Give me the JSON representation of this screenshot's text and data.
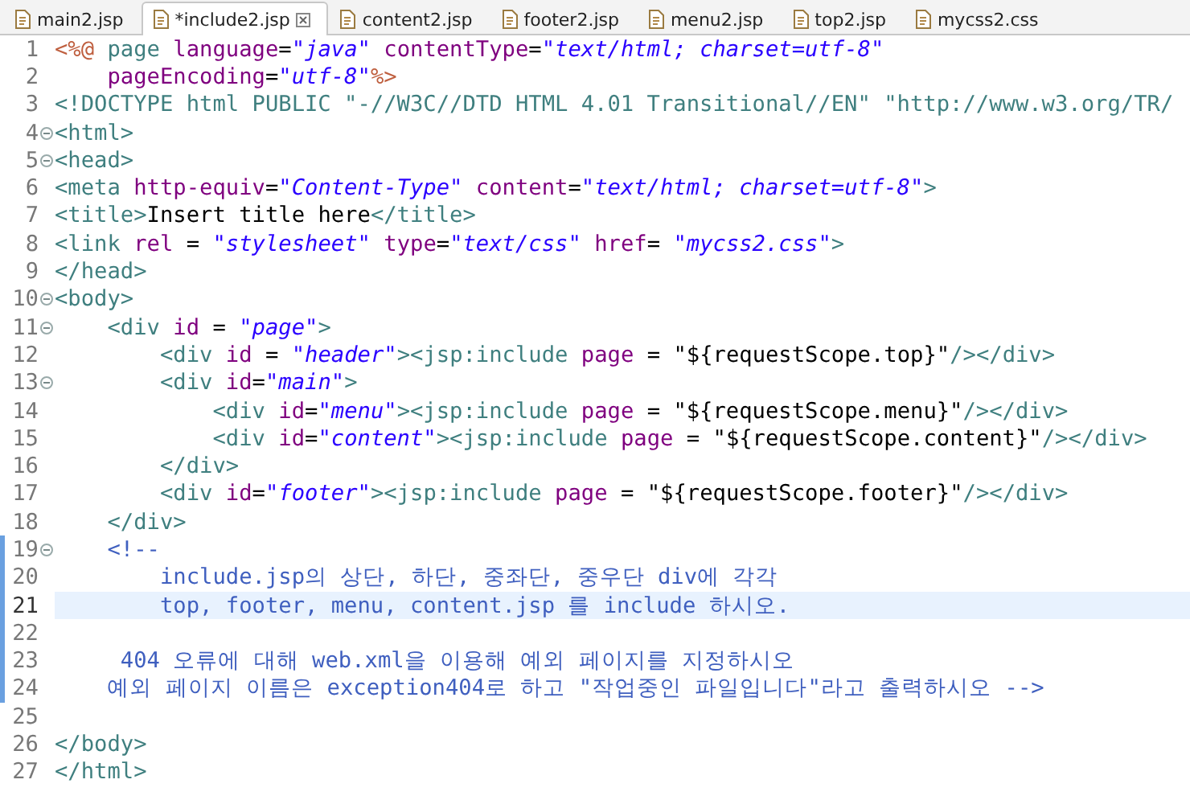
{
  "tabs": [
    {
      "label": "main2.jsp",
      "selected": false
    },
    {
      "label": "*include2.jsp",
      "selected": true
    },
    {
      "label": "content2.jsp",
      "selected": false
    },
    {
      "label": "footer2.jsp",
      "selected": false
    },
    {
      "label": "menu2.jsp",
      "selected": false
    },
    {
      "label": "top2.jsp",
      "selected": false
    },
    {
      "label": "mycss2.css",
      "selected": false
    }
  ],
  "lines": [
    {
      "number": "1",
      "fold": false,
      "changed": false,
      "current": false,
      "tokens": [
        {
          "kind": "directive",
          "text": "<%@"
        },
        {
          "kind": "tag",
          "text": " page"
        },
        {
          "kind": "attr",
          "text": " language"
        },
        {
          "kind": "text",
          "text": "="
        },
        {
          "kind": "string",
          "text": "\"java\""
        },
        {
          "kind": "attr",
          "text": " contentType"
        },
        {
          "kind": "text",
          "text": "="
        },
        {
          "kind": "string",
          "text": "\"text/html; charset=utf-8\""
        }
      ]
    },
    {
      "number": "2",
      "fold": false,
      "changed": false,
      "current": false,
      "tokens": [
        {
          "kind": "attr",
          "text": "    pageEncoding"
        },
        {
          "kind": "text",
          "text": "="
        },
        {
          "kind": "string",
          "text": "\"utf-8\""
        },
        {
          "kind": "directive",
          "text": "%>"
        }
      ]
    },
    {
      "number": "3",
      "fold": false,
      "changed": false,
      "current": false,
      "tokens": [
        {
          "kind": "tag",
          "text": "<!DOCTYPE html PUBLIC \"-//W3C//DTD HTML 4.01 Transitional//EN\" \"http://www.w3.org/TR/"
        }
      ]
    },
    {
      "number": "4",
      "fold": true,
      "changed": false,
      "current": false,
      "tokens": [
        {
          "kind": "tag",
          "text": "<html>"
        }
      ]
    },
    {
      "number": "5",
      "fold": true,
      "changed": false,
      "current": false,
      "tokens": [
        {
          "kind": "tag",
          "text": "<head>"
        }
      ]
    },
    {
      "number": "6",
      "fold": false,
      "changed": false,
      "current": false,
      "tokens": [
        {
          "kind": "tag",
          "text": "<meta"
        },
        {
          "kind": "attr",
          "text": " http-equiv"
        },
        {
          "kind": "text",
          "text": "="
        },
        {
          "kind": "string",
          "text": "\"Content-Type\""
        },
        {
          "kind": "attr",
          "text": " content"
        },
        {
          "kind": "text",
          "text": "="
        },
        {
          "kind": "string",
          "text": "\"text/html; charset=utf-8\""
        },
        {
          "kind": "tag",
          "text": ">"
        }
      ]
    },
    {
      "number": "7",
      "fold": false,
      "changed": false,
      "current": false,
      "tokens": [
        {
          "kind": "tag",
          "text": "<title>"
        },
        {
          "kind": "text",
          "text": "Insert title here"
        },
        {
          "kind": "tag",
          "text": "</title>"
        }
      ]
    },
    {
      "number": "8",
      "fold": false,
      "changed": false,
      "current": false,
      "tokens": [
        {
          "kind": "tag",
          "text": "<link"
        },
        {
          "kind": "attr",
          "text": " rel"
        },
        {
          "kind": "text",
          "text": " = "
        },
        {
          "kind": "string",
          "text": "\"stylesheet\""
        },
        {
          "kind": "attr",
          "text": " type"
        },
        {
          "kind": "text",
          "text": "="
        },
        {
          "kind": "string",
          "text": "\"text/css\""
        },
        {
          "kind": "attr",
          "text": " href"
        },
        {
          "kind": "text",
          "text": "= "
        },
        {
          "kind": "string",
          "text": "\"mycss2.css\""
        },
        {
          "kind": "tag",
          "text": ">"
        }
      ]
    },
    {
      "number": "9",
      "fold": false,
      "changed": false,
      "current": false,
      "tokens": [
        {
          "kind": "tag",
          "text": "</head>"
        }
      ]
    },
    {
      "number": "10",
      "fold": true,
      "changed": false,
      "current": false,
      "tokens": [
        {
          "kind": "tag",
          "text": "<body>"
        }
      ]
    },
    {
      "number": "11",
      "fold": true,
      "changed": false,
      "current": false,
      "tokens": [
        {
          "kind": "tag",
          "text": "    <div"
        },
        {
          "kind": "attr",
          "text": " id"
        },
        {
          "kind": "text",
          "text": " = "
        },
        {
          "kind": "string",
          "text": "\"page\""
        },
        {
          "kind": "tag",
          "text": ">"
        }
      ]
    },
    {
      "number": "12",
      "fold": false,
      "changed": false,
      "current": false,
      "tokens": [
        {
          "kind": "tag",
          "text": "        <div"
        },
        {
          "kind": "attr",
          "text": " id"
        },
        {
          "kind": "text",
          "text": " = "
        },
        {
          "kind": "string",
          "text": "\"header\""
        },
        {
          "kind": "tag",
          "text": "><jsp:include"
        },
        {
          "kind": "attr",
          "text": " page"
        },
        {
          "kind": "text",
          "text": " = \"${requestScope.top}\""
        },
        {
          "kind": "tag",
          "text": "/></div>"
        }
      ]
    },
    {
      "number": "13",
      "fold": true,
      "changed": false,
      "current": false,
      "tokens": [
        {
          "kind": "tag",
          "text": "        <div"
        },
        {
          "kind": "attr",
          "text": " id"
        },
        {
          "kind": "text",
          "text": "="
        },
        {
          "kind": "string",
          "text": "\"main\""
        },
        {
          "kind": "tag",
          "text": ">"
        }
      ]
    },
    {
      "number": "14",
      "fold": false,
      "changed": false,
      "current": false,
      "tokens": [
        {
          "kind": "tag",
          "text": "            <div"
        },
        {
          "kind": "attr",
          "text": " id"
        },
        {
          "kind": "text",
          "text": "="
        },
        {
          "kind": "string",
          "text": "\"menu\""
        },
        {
          "kind": "tag",
          "text": "><jsp:include"
        },
        {
          "kind": "attr",
          "text": " page"
        },
        {
          "kind": "text",
          "text": " = \"${requestScope.menu}\""
        },
        {
          "kind": "tag",
          "text": "/></div>"
        }
      ]
    },
    {
      "number": "15",
      "fold": false,
      "changed": false,
      "current": false,
      "tokens": [
        {
          "kind": "tag",
          "text": "            <div"
        },
        {
          "kind": "attr",
          "text": " id"
        },
        {
          "kind": "text",
          "text": "="
        },
        {
          "kind": "string",
          "text": "\"content\""
        },
        {
          "kind": "tag",
          "text": "><jsp:include"
        },
        {
          "kind": "attr",
          "text": " page"
        },
        {
          "kind": "text",
          "text": " = \"${requestScope.content}\""
        },
        {
          "kind": "tag",
          "text": "/></div>"
        }
      ]
    },
    {
      "number": "16",
      "fold": false,
      "changed": false,
      "current": false,
      "tokens": [
        {
          "kind": "tag",
          "text": "        </div>"
        }
      ]
    },
    {
      "number": "17",
      "fold": false,
      "changed": false,
      "current": false,
      "tokens": [
        {
          "kind": "tag",
          "text": "        <div"
        },
        {
          "kind": "attr",
          "text": " id"
        },
        {
          "kind": "text",
          "text": "="
        },
        {
          "kind": "string",
          "text": "\"footer\""
        },
        {
          "kind": "tag",
          "text": "><jsp:include"
        },
        {
          "kind": "attr",
          "text": " page"
        },
        {
          "kind": "text",
          "text": " = \"${requestScope.footer}\""
        },
        {
          "kind": "tag",
          "text": "/></div>"
        }
      ]
    },
    {
      "number": "18",
      "fold": false,
      "changed": false,
      "current": false,
      "tokens": [
        {
          "kind": "tag",
          "text": "    </div>"
        }
      ]
    },
    {
      "number": "19",
      "fold": true,
      "changed": true,
      "current": false,
      "tokens": [
        {
          "kind": "comment",
          "text": "    <!--"
        }
      ]
    },
    {
      "number": "20",
      "fold": false,
      "changed": true,
      "current": false,
      "tokens": [
        {
          "kind": "comment",
          "text": "        include.jsp의 상단, 하단, 중좌단, 중우단 div에 각각"
        }
      ]
    },
    {
      "number": "21",
      "fold": false,
      "changed": true,
      "current": true,
      "tokens": [
        {
          "kind": "comment",
          "text": "        top, footer, menu, content.jsp 를 include 하시오."
        }
      ]
    },
    {
      "number": "22",
      "fold": false,
      "changed": true,
      "current": false
    },
    {
      "number": "23",
      "fold": false,
      "changed": true,
      "current": false,
      "tokens": [
        {
          "kind": "comment",
          "text": "     404 오류에 대해 web.xml을 이용해 예외 페이지를 지정하시오"
        }
      ]
    },
    {
      "number": "24",
      "fold": false,
      "changed": true,
      "current": false,
      "tokens": [
        {
          "kind": "comment",
          "text": "    예외 페이지 이름은 exception404로 하고 \"작업중인 파일입니다\"라고 출력하시오 -->"
        }
      ]
    },
    {
      "number": "25",
      "fold": false,
      "changed": false,
      "current": false
    },
    {
      "number": "26",
      "fold": false,
      "changed": false,
      "current": false,
      "tokens": [
        {
          "kind": "tag",
          "text": "</body>"
        }
      ]
    },
    {
      "number": "27",
      "fold": false,
      "changed": false,
      "current": false,
      "tokens": [
        {
          "kind": "tag",
          "text": "</html>"
        }
      ]
    }
  ]
}
